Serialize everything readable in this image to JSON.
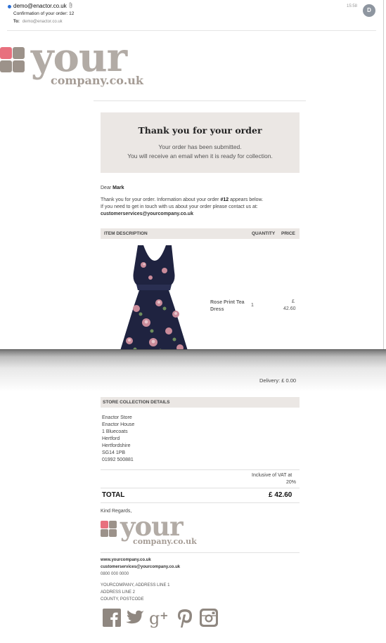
{
  "mail": {
    "from": "demo@enactor.co.uk",
    "subject": "Confirmation of your order: 12",
    "to_label": "To:",
    "to_address": "demo@enactor.co.uk",
    "time": "15:58",
    "avatar_initial": "D"
  },
  "brand": {
    "logo_word": "your",
    "logo_sub": "company.co.uk",
    "colors": {
      "pink": "#e8707e",
      "taupe": "#9c928a",
      "taupe_light": "#b2aba5"
    }
  },
  "banner": {
    "title": "Thank you for your order",
    "line1": "Your order has been submitted.",
    "line2": "You will receive an email when it is ready for collection."
  },
  "greeting": {
    "prefix": "Dear",
    "name": "Mark"
  },
  "message": {
    "line1_pre": "Thank you for your order. Information about your order",
    "order_ref": "#12",
    "line1_post": "appears below.",
    "line2": "If you need to get in touch with us about your order please contact us at:",
    "email": "customerservices@yourcompany.co.uk"
  },
  "table": {
    "col_desc": "ITEM DESCRIPTION",
    "col_qty": "QUANTITY",
    "col_price": "PRICE",
    "items": [
      {
        "name_line1": "Rose Print Tea",
        "name_line2": "Dress",
        "qty": "1",
        "currency": "£",
        "price": "42.60",
        "image": "floral-dress-image"
      }
    ]
  },
  "delivery": "Delivery: £ 0.00",
  "store": {
    "heading": "STORE COLLECTION DETAILS",
    "lines": [
      "Enactor Store",
      "Enactor House",
      "1 Bluecoats",
      "Hertford",
      "Hertfordshire",
      "SG14 1PB",
      "01992 500881"
    ]
  },
  "vat": {
    "line1": "Inclusive of VAT at",
    "line2": "20%"
  },
  "total": {
    "label": "TOTAL",
    "value": "£ 42.60"
  },
  "signoff": "Kind Regards,",
  "footer": {
    "website": "www.yourcompany.co.uk",
    "email": "customerservices@yourcompany.co.uk",
    "phone": "0800 000 0000",
    "address1": "YOURCOMPANY, ADDRESS LINE 1",
    "address2": "ADDRESS LINE 2",
    "address3": "COUNTY, POSTCODE"
  },
  "social_icons": [
    "facebook-icon",
    "twitter-icon",
    "google-plus-icon",
    "pinterest-icon",
    "instagram-icon"
  ]
}
